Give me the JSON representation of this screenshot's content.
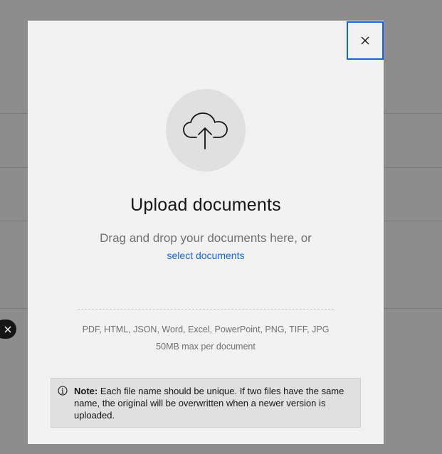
{
  "modal": {
    "title": "Upload documents",
    "drag_text": "Drag and drop your documents here, or",
    "select_link": "select documents",
    "formats": "PDF, HTML, JSON, Word, Excel, PowerPoint, PNG, TIFF, JPG",
    "max_size": "50MB max per document",
    "note": {
      "label": "Note:",
      "text": " Each file name should be unique. If two files have the same name, the original will be overwritten when a newer version is uploaded."
    },
    "icons": {
      "close": "close-icon",
      "upload": "cloud-upload-icon",
      "info": "info-icon"
    }
  },
  "colors": {
    "accent": "#0f62fe",
    "modal_bg": "#f2f2f2",
    "overlay": "#8d8d8d",
    "text_primary": "#161616",
    "text_secondary": "#6f6f6f"
  }
}
